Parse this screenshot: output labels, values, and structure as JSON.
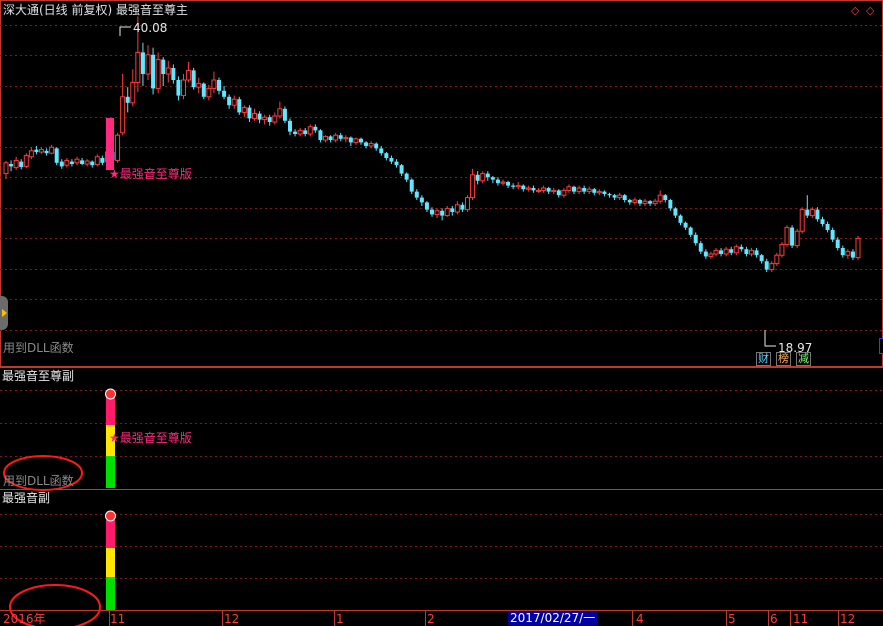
{
  "main_panel": {
    "title": "深大通(日线 前复权) 最强音至尊主",
    "dll_text": "用到DLL函数",
    "signal_label": "★最强音至尊版",
    "price_high_label": "40.08",
    "price_low_label": "18.97",
    "badges": [
      {
        "label": "财",
        "color": "#5fd0ff"
      },
      {
        "label": "榜",
        "color": "#ffb060"
      },
      {
        "label": "减",
        "color": "#7fff7f"
      }
    ],
    "up_color": "#ff3b3b",
    "down_color": "#5fe8ff",
    "prices": [
      [
        -0.6,
        1.2,
        -1.5,
        1.5
      ],
      [
        1.0,
        0.6,
        -0.2,
        1.6
      ],
      [
        0.4,
        1.6,
        0.0,
        2.2
      ],
      [
        1.4,
        0.5,
        0.1,
        1.8
      ],
      [
        0.6,
        2.4,
        0.3,
        2.8
      ],
      [
        2.2,
        3.2,
        1.8,
        3.8
      ],
      [
        3.4,
        3.0,
        2.6,
        4.0
      ],
      [
        3.0,
        3.4,
        2.7,
        3.8
      ],
      [
        3.2,
        2.8,
        2.4,
        3.6
      ],
      [
        2.8,
        3.8,
        2.6,
        4.2
      ],
      [
        3.6,
        1.2,
        0.8,
        3.8
      ],
      [
        1.4,
        0.6,
        0.2,
        1.8
      ],
      [
        0.8,
        1.6,
        0.4,
        2.0
      ],
      [
        1.4,
        1.0,
        0.6,
        1.8
      ],
      [
        1.2,
        1.8,
        0.8,
        2.2
      ],
      [
        1.6,
        1.0,
        0.8,
        2.0
      ],
      [
        1.0,
        1.5,
        0.6,
        1.8
      ],
      [
        1.4,
        0.8,
        0.4,
        1.6
      ],
      [
        0.9,
        2.2,
        0.6,
        2.6
      ],
      [
        2.0,
        1.2,
        0.8,
        2.4
      ],
      [
        1.4,
        3.0,
        0.8,
        3.4
      ],
      [
        3.0,
        1.6,
        1.2,
        3.2
      ],
      [
        1.6,
        5.8,
        1.2,
        6.2
      ],
      [
        6.2,
        12.2,
        5.8,
        16.0
      ],
      [
        12.2,
        11.2,
        9.6,
        13.8
      ],
      [
        11.2,
        14.6,
        10.6,
        16.8
      ],
      [
        14.6,
        19.6,
        13.0,
        25.6
      ],
      [
        19.6,
        16.0,
        14.0,
        21.2
      ],
      [
        16.0,
        19.2,
        15.0,
        20.8
      ],
      [
        19.2,
        13.6,
        12.6,
        20.4
      ],
      [
        13.6,
        18.4,
        12.8,
        19.6
      ],
      [
        18.4,
        16.0,
        14.0,
        18.8
      ],
      [
        16.0,
        17.0,
        14.6,
        18.2
      ],
      [
        17.0,
        15.0,
        14.4,
        17.6
      ],
      [
        15.0,
        12.4,
        11.6,
        15.6
      ],
      [
        12.4,
        15.0,
        11.8,
        16.0
      ],
      [
        15.0,
        16.6,
        14.6,
        18.0
      ],
      [
        16.6,
        13.8,
        13.4,
        17.0
      ],
      [
        13.8,
        14.4,
        12.8,
        15.4
      ],
      [
        14.4,
        12.2,
        11.8,
        14.6
      ],
      [
        12.2,
        13.6,
        11.6,
        14.2
      ],
      [
        13.6,
        15.0,
        12.8,
        16.4
      ],
      [
        15.0,
        13.2,
        12.6,
        15.4
      ],
      [
        13.2,
        12.2,
        11.8,
        14.0
      ],
      [
        12.2,
        10.8,
        10.2,
        12.6
      ],
      [
        10.8,
        11.8,
        10.2,
        12.4
      ],
      [
        11.8,
        9.6,
        9.2,
        12.2
      ],
      [
        9.6,
        10.4,
        8.8,
        10.8
      ],
      [
        10.4,
        8.6,
        8.0,
        10.8
      ],
      [
        8.6,
        9.4,
        8.2,
        10.2
      ],
      [
        9.4,
        8.4,
        7.8,
        9.8
      ],
      [
        8.4,
        8.8,
        7.6,
        9.2
      ],
      [
        8.8,
        8.0,
        7.4,
        9.2
      ],
      [
        8.0,
        9.0,
        7.6,
        9.6
      ],
      [
        9.0,
        10.2,
        8.6,
        11.4
      ],
      [
        10.2,
        8.2,
        7.8,
        10.6
      ],
      [
        8.2,
        6.4,
        5.8,
        8.6
      ],
      [
        6.4,
        6.0,
        5.6,
        6.8
      ],
      [
        6.0,
        6.6,
        5.6,
        7.0
      ],
      [
        6.6,
        6.0,
        5.6,
        7.0
      ],
      [
        6.0,
        7.2,
        5.6,
        7.6
      ],
      [
        7.2,
        6.6,
        6.2,
        7.6
      ],
      [
        6.6,
        5.0,
        4.6,
        6.8
      ],
      [
        5.0,
        5.6,
        4.6,
        5.8
      ],
      [
        5.6,
        5.0,
        4.6,
        5.8
      ],
      [
        5.0,
        5.8,
        4.6,
        6.2
      ],
      [
        5.8,
        5.2,
        4.8,
        6.2
      ],
      [
        5.2,
        5.4,
        4.6,
        5.8
      ],
      [
        5.4,
        4.6,
        4.0,
        5.6
      ],
      [
        4.6,
        5.2,
        4.2,
        5.4
      ],
      [
        5.2,
        4.6,
        4.2,
        5.4
      ],
      [
        4.6,
        4.0,
        3.6,
        4.8
      ],
      [
        4.0,
        4.4,
        3.6,
        4.8
      ],
      [
        4.4,
        3.6,
        3.2,
        4.6
      ],
      [
        3.6,
        2.8,
        2.4,
        4.0
      ],
      [
        2.8,
        2.0,
        1.6,
        3.0
      ],
      [
        2.0,
        1.4,
        1.0,
        2.4
      ],
      [
        1.4,
        0.8,
        0.4,
        1.8
      ],
      [
        0.8,
        -0.6,
        -1.0,
        1.0
      ],
      [
        -0.6,
        -1.6,
        -2.0,
        -0.4
      ],
      [
        -1.6,
        -3.6,
        -4.0,
        -1.4
      ],
      [
        -3.6,
        -4.6,
        -5.0,
        -3.2
      ],
      [
        -4.6,
        -5.4,
        -6.0,
        -4.2
      ],
      [
        -5.4,
        -6.6,
        -7.0,
        -5.2
      ],
      [
        -6.6,
        -7.4,
        -7.8,
        -6.2
      ],
      [
        -7.4,
        -6.8,
        -8.0,
        -6.4
      ],
      [
        -6.8,
        -7.6,
        -8.4,
        -6.4
      ],
      [
        -7.6,
        -6.4,
        -7.8,
        -6.0
      ],
      [
        -6.4,
        -7.0,
        -7.6,
        -6.0
      ],
      [
        -7.0,
        -5.8,
        -7.4,
        -5.2
      ],
      [
        -5.8,
        -6.6,
        -7.0,
        -5.4
      ],
      [
        -6.6,
        -4.6,
        -7.0,
        -4.2
      ],
      [
        -4.6,
        -0.8,
        -5.0,
        0.2
      ],
      [
        -0.8,
        -1.8,
        -2.4,
        -0.2
      ],
      [
        -1.8,
        -0.6,
        -2.2,
        -0.2
      ],
      [
        -0.6,
        -1.2,
        -1.8,
        -0.2
      ],
      [
        -1.2,
        -1.6,
        -2.2,
        -1.0
      ],
      [
        -1.6,
        -2.2,
        -2.6,
        -1.2
      ],
      [
        -2.2,
        -2.0,
        -2.6,
        -1.6
      ],
      [
        -2.0,
        -2.6,
        -3.0,
        -1.8
      ],
      [
        -2.6,
        -2.8,
        -3.2,
        -2.2
      ],
      [
        -2.8,
        -2.6,
        -3.2,
        -2.0
      ],
      [
        -2.6,
        -3.2,
        -3.6,
        -2.4
      ],
      [
        -3.2,
        -3.0,
        -3.6,
        -2.6
      ],
      [
        -3.0,
        -3.4,
        -3.8,
        -2.6
      ],
      [
        -3.4,
        -3.4,
        -3.8,
        -3.0
      ],
      [
        -3.4,
        -3.0,
        -3.8,
        -2.6
      ],
      [
        -3.0,
        -3.6,
        -4.0,
        -2.8
      ],
      [
        -3.6,
        -3.4,
        -4.0,
        -3.0
      ],
      [
        -3.4,
        -4.2,
        -4.6,
        -3.2
      ],
      [
        -4.2,
        -3.4,
        -4.6,
        -3.0
      ],
      [
        -3.4,
        -2.8,
        -3.8,
        -2.4
      ],
      [
        -2.8,
        -3.6,
        -4.0,
        -2.6
      ],
      [
        -3.6,
        -3.0,
        -4.0,
        -2.6
      ],
      [
        -3.0,
        -3.6,
        -4.0,
        -2.6
      ],
      [
        -3.6,
        -3.2,
        -4.0,
        -2.8
      ],
      [
        -3.2,
        -3.8,
        -4.2,
        -3.0
      ],
      [
        -3.8,
        -3.6,
        -4.2,
        -3.2
      ],
      [
        -3.6,
        -4.0,
        -4.4,
        -3.4
      ],
      [
        -4.0,
        -4.2,
        -4.6,
        -3.8
      ],
      [
        -4.2,
        -4.6,
        -5.0,
        -4.0
      ],
      [
        -4.6,
        -4.2,
        -5.0,
        -3.8
      ],
      [
        -4.2,
        -5.0,
        -5.4,
        -4.0
      ],
      [
        -5.0,
        -5.4,
        -5.8,
        -4.8
      ],
      [
        -5.4,
        -5.0,
        -5.8,
        -4.6
      ],
      [
        -5.0,
        -5.6,
        -6.0,
        -4.8
      ],
      [
        -5.6,
        -5.2,
        -6.0,
        -4.8
      ],
      [
        -5.2,
        -5.6,
        -6.0,
        -5.0
      ],
      [
        -5.6,
        -5.2,
        -6.0,
        -4.8
      ],
      [
        -5.2,
        -4.2,
        -5.6,
        -3.4
      ],
      [
        -4.2,
        -5.0,
        -5.4,
        -4.0
      ],
      [
        -5.0,
        -6.4,
        -6.8,
        -4.8
      ],
      [
        -6.4,
        -7.6,
        -8.0,
        -6.2
      ],
      [
        -7.6,
        -8.8,
        -9.2,
        -7.4
      ],
      [
        -8.8,
        -9.6,
        -10.0,
        -8.6
      ],
      [
        -9.6,
        -10.8,
        -11.2,
        -9.4
      ],
      [
        -10.8,
        -12.2,
        -12.6,
        -10.4
      ],
      [
        -12.2,
        -13.6,
        -14.0,
        -11.8
      ],
      [
        -13.6,
        -14.4,
        -14.8,
        -13.2
      ],
      [
        -14.4,
        -14.0,
        -14.8,
        -13.6
      ],
      [
        -14.0,
        -13.4,
        -14.4,
        -13.0
      ],
      [
        -13.4,
        -14.0,
        -14.4,
        -13.0
      ],
      [
        -14.0,
        -13.2,
        -14.4,
        -12.8
      ],
      [
        -13.2,
        -13.8,
        -14.2,
        -12.8
      ],
      [
        -13.8,
        -12.8,
        -14.2,
        -12.4
      ],
      [
        -12.8,
        -13.2,
        -13.6,
        -12.4
      ],
      [
        -13.2,
        -14.0,
        -14.4,
        -12.8
      ],
      [
        -14.0,
        -13.4,
        -14.4,
        -13.0
      ],
      [
        -13.4,
        -14.2,
        -14.6,
        -13.0
      ],
      [
        -14.2,
        -15.2,
        -15.6,
        -14.0
      ],
      [
        -15.2,
        -16.6,
        -17.0,
        -14.8
      ],
      [
        -16.6,
        -15.6,
        -17.0,
        -15.2
      ],
      [
        -15.6,
        -14.2,
        -16.0,
        -13.8
      ],
      [
        -14.2,
        -12.4,
        -14.6,
        -12.0
      ],
      [
        -12.4,
        -9.6,
        -12.8,
        -9.2
      ],
      [
        -9.6,
        -12.6,
        -13.0,
        -9.2
      ],
      [
        -12.6,
        -10.2,
        -13.0,
        -9.8
      ],
      [
        -10.2,
        -6.6,
        -10.6,
        -6.2
      ],
      [
        -6.6,
        -7.6,
        -8.0,
        -4.2
      ],
      [
        -7.6,
        -6.6,
        -8.0,
        -6.2
      ],
      [
        -6.6,
        -8.2,
        -8.6,
        -6.2
      ],
      [
        -8.2,
        -9.0,
        -9.4,
        -7.8
      ],
      [
        -9.0,
        -10.0,
        -10.4,
        -8.6
      ],
      [
        -10.0,
        -11.6,
        -12.0,
        -9.6
      ],
      [
        -11.6,
        -13.0,
        -13.4,
        -11.2
      ],
      [
        -13.0,
        -14.2,
        -14.6,
        -12.6
      ],
      [
        -14.2,
        -13.6,
        -14.8,
        -13.2
      ],
      [
        -13.6,
        -14.6,
        -15.0,
        -13.2
      ],
      [
        -14.6,
        -11.4,
        -15.0,
        -11.0
      ]
    ]
  },
  "sub_panel_1": {
    "title": "最强音至尊副",
    "dll_text": "用到DLL函数",
    "signal_label": "★最强音至尊版"
  },
  "sub_panel_2": {
    "title": "最强音副"
  },
  "x_axis": {
    "labels": [
      "2016年",
      "11",
      "12",
      "1",
      "2",
      "2017/02/27/一",
      "4",
      "5",
      "6",
      "11",
      "12"
    ]
  },
  "window_controls": [
    "◇",
    "◇"
  ]
}
